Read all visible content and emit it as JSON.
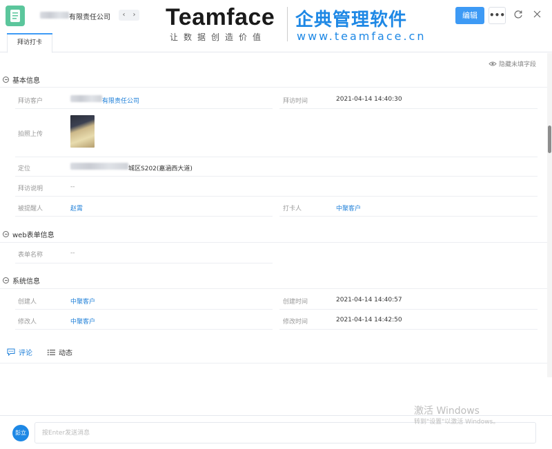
{
  "header": {
    "title_suffix": "有限责任公司",
    "nav_prev": "‹",
    "nav_next": "›",
    "edit_label": "编辑",
    "more_label": "•••"
  },
  "brand": {
    "logo": "Teamface",
    "slogan": "让数据创造价值",
    "cn_name": "企典管理软件",
    "url": "www.teamface.cn"
  },
  "tabs": [
    {
      "label": "拜访打卡",
      "active": true
    }
  ],
  "hide_toggle_label": "隐藏未填字段",
  "sections": {
    "basic": {
      "title": "基本信息"
    },
    "web_form": {
      "title": "web表单信息"
    },
    "system": {
      "title": "系统信息"
    }
  },
  "fields": {
    "visit_customer": {
      "label": "拜访客户",
      "value": "有限责任公司"
    },
    "visit_time": {
      "label": "拜访时间",
      "value": "2021-04-14 14:40:30"
    },
    "photo_upload": {
      "label": "拍照上传"
    },
    "location": {
      "label": "定位",
      "value": "城区S202(嘉涵西大道)"
    },
    "visit_note": {
      "label": "拜访说明",
      "value": "--"
    },
    "reminded_person": {
      "label": "被提醒人",
      "value": "赵霄"
    },
    "checkin_person": {
      "label": "打卡人",
      "value": "中聚客户"
    },
    "form_name": {
      "label": "表单名称",
      "value": "--"
    },
    "creator": {
      "label": "创建人",
      "value": "中聚客户"
    },
    "create_time": {
      "label": "创建时间",
      "value": "2021-04-14 14:40:57"
    },
    "modifier": {
      "label": "修改人",
      "value": "中聚客户"
    },
    "modify_time": {
      "label": "修改时间",
      "value": "2021-04-14 14:42:50"
    }
  },
  "comment_tabs": [
    {
      "label": "评论",
      "active": true
    },
    {
      "label": "动态",
      "active": false
    }
  ],
  "bottom": {
    "avatar_text": "彭立",
    "input_placeholder": "按Enter发送消息"
  },
  "watermark": {
    "line1": "激活 Windows",
    "line2": "转到\"设置\"以激活 Windows。"
  },
  "colors": {
    "accent": "#3d9af5",
    "link": "#1e7fd8",
    "app_icon": "#5bc69c",
    "brand_blue": "#1e88e5"
  },
  "icons": [
    "document-icon",
    "chevron-left-icon",
    "chevron-right-icon",
    "more-icon",
    "refresh-icon",
    "close-icon",
    "eye-icon",
    "collapse-icon",
    "comment-icon",
    "list-icon"
  ]
}
